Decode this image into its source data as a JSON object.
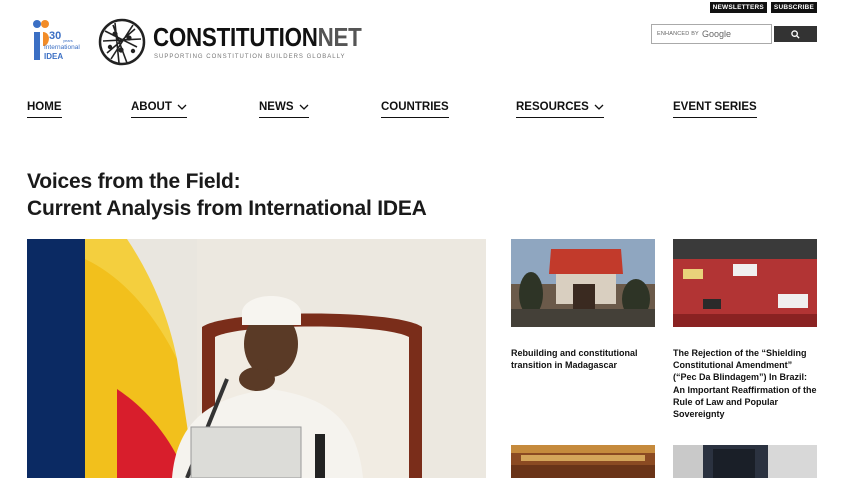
{
  "top_links": {
    "newsletters": "NEWSLETTERS",
    "subscribe": "SUBSCRIBE"
  },
  "idea_logo": {
    "number": "30",
    "years": "years",
    "line1": "International",
    "line2": "IDEA"
  },
  "brand": {
    "name_part1": "CONSTITUTION",
    "name_part2": "NET",
    "tagline": "SUPPORTING CONSTITUTION BUILDERS GLOBALLY"
  },
  "search": {
    "label_small": "ENHANCED BY",
    "label_google": "Google"
  },
  "nav": {
    "home": "HOME",
    "about": "ABOUT",
    "news": "NEWS",
    "countries": "COUNTRIES",
    "resources": "RESOURCES",
    "event_series": "EVENT SERIES"
  },
  "headline": {
    "line1": "Voices from the Field:",
    "line2": "Current Analysis from International IDEA"
  },
  "cards": [
    {
      "title": "Rebuilding and constitutional transition in Madagascar"
    },
    {
      "title": "The Rejection of the “Shielding Constitutional Amendment” (“Pec Da Blindagem”) In Brazil: An Important Reaffirmation of the Rule of Law and Popular Sovereignty"
    }
  ],
  "colors": {
    "nav_underline": "#111111",
    "button_bg": "#333333",
    "top_link_bg": "#111111"
  }
}
